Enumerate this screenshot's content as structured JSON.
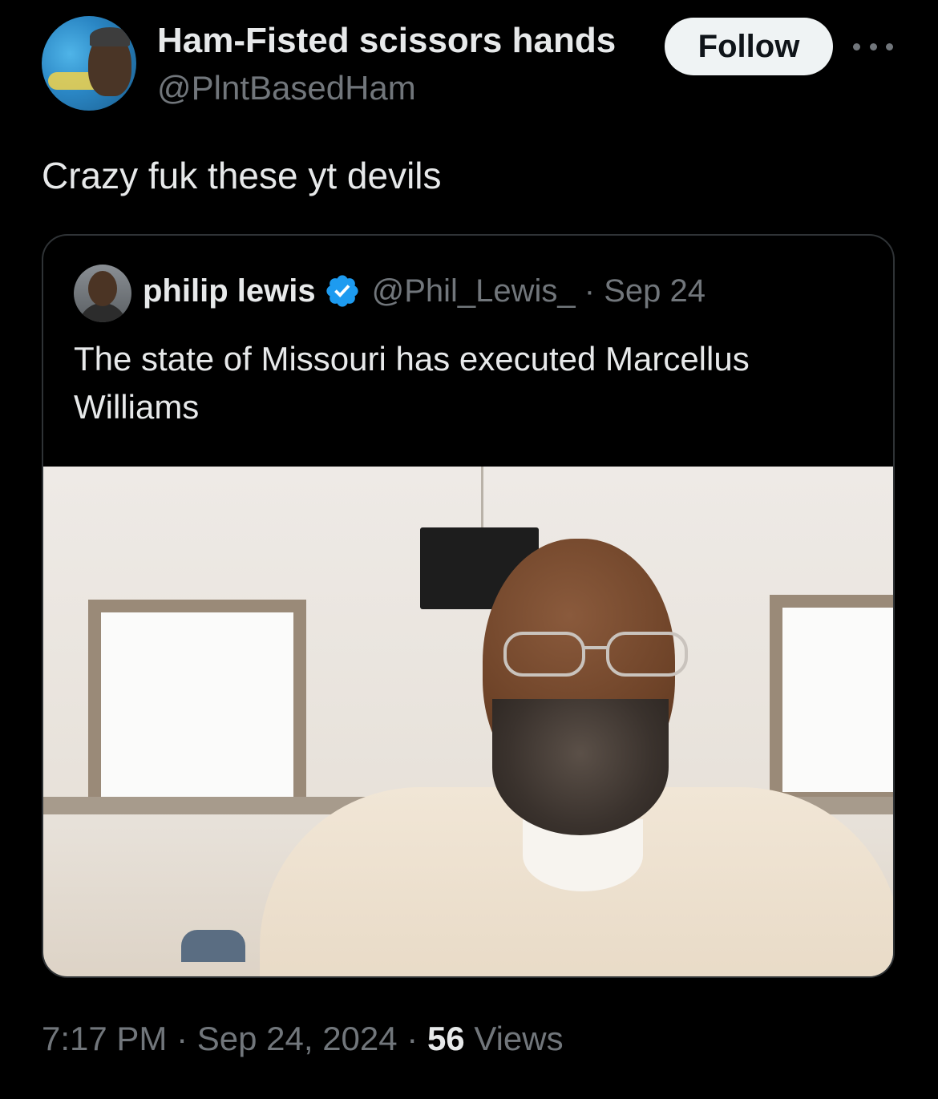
{
  "author": {
    "display_name": "Ham-Fisted scissors hands",
    "handle": "@PlntBasedHam",
    "follow_label": "Follow"
  },
  "tweet": {
    "text": "Crazy fuk these yt devils"
  },
  "quoted": {
    "display_name": "philip lewis",
    "verified": true,
    "handle_date": "@Phil_Lewis_ · Sep 24",
    "text": "The state of Missouri has executed Marcellus Williams"
  },
  "meta": {
    "time_date": "7:17 PM · Sep 24, 2024 · ",
    "views_count": "56",
    "views_label": " Views"
  },
  "colors": {
    "background": "#000000",
    "text_primary": "#e7e9ea",
    "text_secondary": "#71767b",
    "verified_blue": "#1d9bf0",
    "follow_bg": "#eff3f4"
  },
  "icons": [
    "more-icon",
    "verified-badge-icon"
  ]
}
